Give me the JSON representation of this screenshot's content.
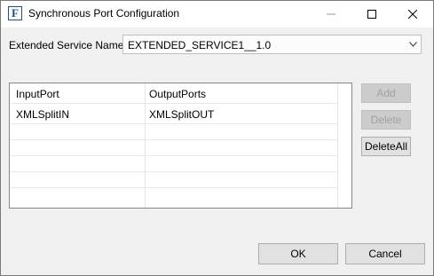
{
  "window": {
    "title": "Synchronous Port Configuration",
    "app_icon_letter": "F"
  },
  "service": {
    "label": "Extended Service Name",
    "selected": "EXTENDED_SERVICE1__1.0"
  },
  "table": {
    "headers": [
      "InputPort",
      "OutputPorts"
    ],
    "rows": [
      [
        "XMLSplitIN",
        "XMLSplitOUT"
      ]
    ]
  },
  "side_buttons": {
    "add": "Add",
    "delete": "Delete",
    "delete_all": "DeleteAll"
  },
  "footer": {
    "ok": "OK",
    "cancel": "Cancel"
  },
  "icons": {
    "app": "app-logo-icon",
    "minimize": "minimize-icon",
    "maximize": "maximize-icon",
    "close": "close-icon",
    "dropdown": "chevron-down-icon"
  }
}
